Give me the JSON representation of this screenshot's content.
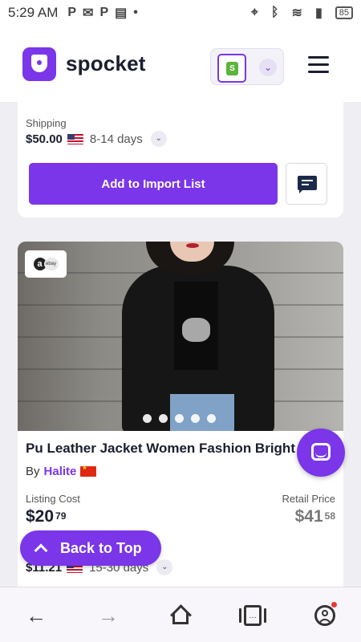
{
  "status_bar": {
    "time": "5:29 AM",
    "battery": "85",
    "icons": [
      "parking-icon",
      "messenger-icon",
      "parking-icon",
      "news-icon",
      "dot-icon",
      "location-icon",
      "bluetooth-icon",
      "wifi-icon",
      "signal-icon",
      "battery-icon"
    ]
  },
  "header": {
    "logo_text": "spocket",
    "store_platform": "shopify-icon",
    "menu_icon": "hamburger-icon"
  },
  "previous_product": {
    "shipping_label": "Shipping",
    "shipping_price": "$50.00",
    "shipping_days": "8-14 days",
    "add_button_label": "Add to Import List"
  },
  "product": {
    "title": "Pu Leather Jacket Women Fashion Bright",
    "by_prefix": "By",
    "seller": "Halite",
    "listing_cost_label": "Listing Cost",
    "listing_price": "$20",
    "listing_cents": "79",
    "retail_price_label": "Retail Price",
    "retail_price": "$41",
    "retail_cents": "58",
    "shipping_price": "$11.21",
    "shipping_days": "15-30 days",
    "image_count": 5,
    "active_image": 1
  },
  "floating": {
    "back_to_top_label": "Back to Top"
  },
  "colors": {
    "accent": "#7a36e8",
    "dark_text": "#1b1e2e"
  }
}
